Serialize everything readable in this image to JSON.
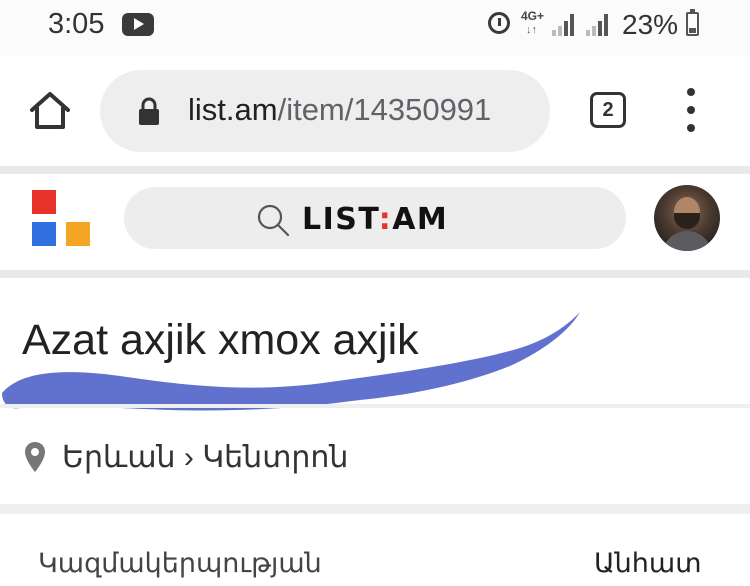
{
  "status_bar": {
    "time": "3:05",
    "network": "4G+",
    "network_arrows": "↓↑",
    "battery": "23%",
    "icons": [
      "youtube-play-icon",
      "alarm-icon",
      "signal-icon",
      "battery-charging-icon"
    ]
  },
  "browser": {
    "url_host": "list.am",
    "url_path": "/item/14350991",
    "tab_count": "2",
    "icons": [
      "home-icon",
      "lock-icon",
      "tabs-icon",
      "menu-icon"
    ]
  },
  "site": {
    "brand_left": "LIST",
    "brand_colon": ":",
    "brand_right": "AM",
    "logo_colors": [
      "#e8332a",
      "#2f6fe0",
      "#f2a623"
    ],
    "icons": [
      "search-icon",
      "avatar"
    ]
  },
  "item": {
    "title": "Azat axjik xmox axjik",
    "location": "Երևան › Կենտրոն",
    "detail_label": "Կազմակերպության",
    "detail_value": "Անհատ"
  },
  "colors": {
    "scribble": "#4f63c8",
    "divider": "#e9e9e9"
  }
}
